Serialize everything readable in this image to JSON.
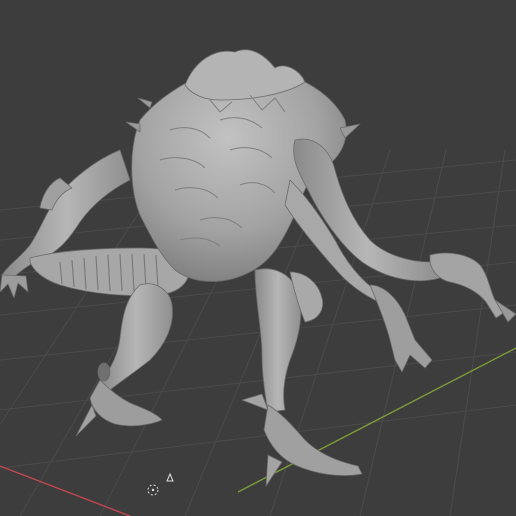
{
  "viewport": {
    "type": "blender-3d-viewport",
    "mode": "perspective",
    "grid_visible": true,
    "x_axis_line_color": "#c1474e",
    "y_axis_line_color": "#7d9a37",
    "background_color": "#3d3d3d",
    "grid_line_color": "#4b4b4b"
  },
  "model": {
    "description_icon": "sculpted-creature-mesh",
    "material_color": "#a6a6a6"
  },
  "gizmos": {
    "origin_icon": "3d-cursor-icon",
    "light_icon": "light-object-icon"
  }
}
